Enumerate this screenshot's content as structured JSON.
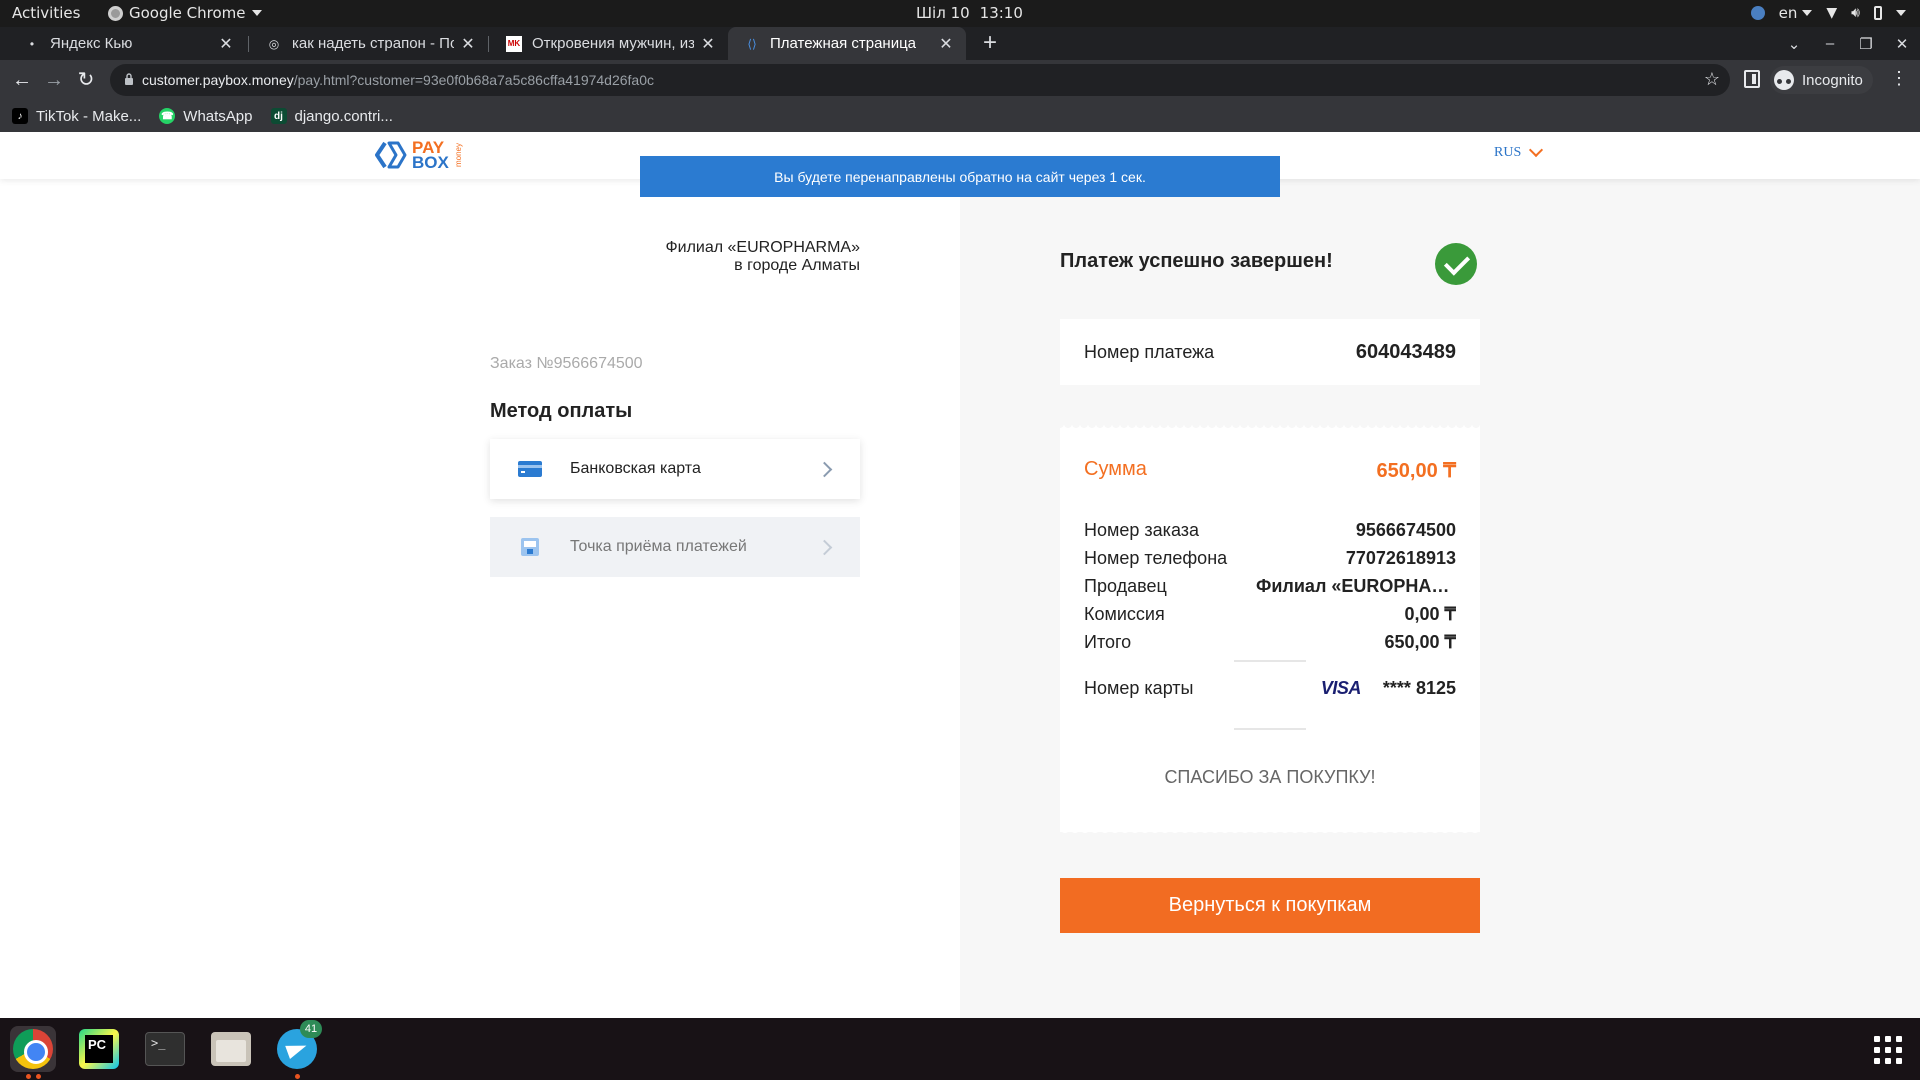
{
  "system_bar": {
    "activities": "Activities",
    "app_name": "Google Chrome",
    "date": "Шіл 10",
    "time": "13:10",
    "lang": "en"
  },
  "tabs": [
    {
      "title": "Яндекс Кью",
      "favicon": "yandex-q-icon"
    },
    {
      "title": "как надеть страпон - Пои",
      "favicon": "globe-icon"
    },
    {
      "title": "Откровения мужчин, изм",
      "favicon": "mk-icon"
    },
    {
      "title": "Платежная страница",
      "favicon": "paybox-icon",
      "active": true
    }
  ],
  "address_bar": {
    "host": "customer.paybox.money",
    "path": "/pay.html?customer=93e0f0b68a7a5c86cffa41974d26fa0c",
    "incognito_label": "Incognito"
  },
  "bookmarks": [
    {
      "label": "TikTok - Make...",
      "icon": "tiktok-icon"
    },
    {
      "label": "WhatsApp",
      "icon": "whatsapp-icon"
    },
    {
      "label": "django.contri...",
      "icon": "django-icon"
    }
  ],
  "page": {
    "logo": {
      "pay": "PAY",
      "box": "BOX",
      "money": "money"
    },
    "language": "RUS",
    "redirect_notice": "Вы будете перенаправлены обратно на сайт через 1 сек.",
    "merchant_line1": "Филиал «EUROPHARMA»",
    "merchant_line2": "в городе Алматы",
    "order_number": "Заказ №9566674500",
    "method_title": "Метод оплаты",
    "methods": [
      {
        "label": "Банковская карта",
        "icon": "credit-card-icon"
      },
      {
        "label": "Точка приёма платежей",
        "icon": "payment-terminal-icon"
      }
    ],
    "success_title": "Платеж успешно завершен!",
    "payment_number_label": "Номер платежа",
    "payment_number_value": "604043489",
    "receipt": {
      "sum_label": "Сумма",
      "sum_value": "650,00 ₸",
      "rows": [
        {
          "label": "Номер заказа",
          "value": "9566674500"
        },
        {
          "label": "Номер телефона",
          "value": "77072618913"
        },
        {
          "label": "Продавец",
          "value": "Филиал «EUROPHARMA»"
        },
        {
          "label": "Комиссия",
          "value": "0,00 ₸"
        },
        {
          "label": "Итого",
          "value": "650,00 ₸"
        }
      ],
      "card_label": "Номер карты",
      "card_brand": "VISA",
      "card_masked": "**** 8125",
      "thanks": "СПАСИБО ЗА ПОКУПКУ!"
    },
    "back_button": "Вернуться к покупкам"
  },
  "dock": {
    "telegram_badge": "41"
  },
  "colors": {
    "accent_orange": "#f26c22",
    "paybox_blue": "#2b74c8",
    "success_green": "#3a9a3a",
    "banner_blue": "#2b7bd1"
  }
}
